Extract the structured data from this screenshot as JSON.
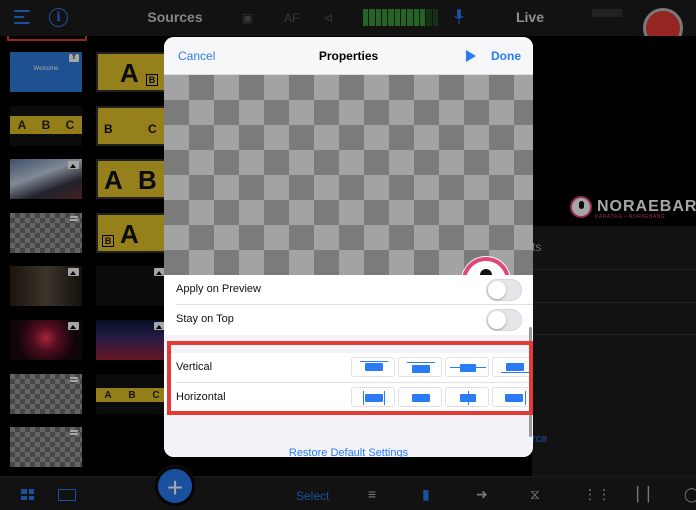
{
  "topbar": {
    "sources_title": "Sources",
    "live_title": "Live",
    "dim_label_af": "AF",
    "icons": [
      "menu-icon",
      "info-icon",
      "camera-icon",
      "share-icon",
      "mic-icon",
      "record-icon"
    ]
  },
  "sources": {
    "tiles": [
      {
        "type": "welcome",
        "label": "Welcome"
      },
      {
        "type": "yellow-ab"
      },
      {
        "type": "abc-strip",
        "letters": [
          "A",
          "B",
          "C"
        ]
      },
      {
        "type": "yellow-ab-bc"
      },
      {
        "type": "photo",
        "subject": "wave"
      },
      {
        "type": "yellow-ab"
      },
      {
        "type": "transparent"
      },
      {
        "type": "yellow-ab"
      },
      {
        "type": "photo",
        "subject": "people"
      },
      {
        "type": "photo",
        "subject": "dark"
      },
      {
        "type": "photo",
        "subject": "concert"
      },
      {
        "type": "photo",
        "subject": "stage"
      },
      {
        "type": "transparent"
      },
      {
        "type": "ab-strip",
        "letters": [
          "A",
          "B",
          "C"
        ]
      },
      {
        "type": "transparent"
      }
    ]
  },
  "live": {
    "brand_name": "NORAEBAR",
    "brand_sub": "KARAOKE • NORAEBANG",
    "partial_text_1": "ts",
    "partial_link": "rce"
  },
  "toolbar": {
    "select_label": "Select",
    "add_label": "+",
    "icons": [
      "grid-icon",
      "tile-icon",
      "sliders-icon",
      "camera-icon",
      "output-icon",
      "transition-icon",
      "audio-icon",
      "levels-icon",
      "chat-icon"
    ]
  },
  "modal": {
    "cancel_label": "Cancel",
    "title": "Properties",
    "done_label": "Done",
    "rows": {
      "apply_on_preview": "Apply on Preview",
      "stay_on_top": "Stay on Top",
      "vertical": "Vertical",
      "horizontal": "Horizontal"
    },
    "restore_label": "Restore Default Settings",
    "vertical_options": [
      "top",
      "center-top",
      "middle",
      "bottom"
    ],
    "horizontal_options": [
      "left",
      "center",
      "center-line",
      "right"
    ]
  },
  "colors": {
    "accent": "#2a7bf5",
    "record": "#e53935",
    "highlight": "#e53935",
    "brand": "#e0457b"
  }
}
